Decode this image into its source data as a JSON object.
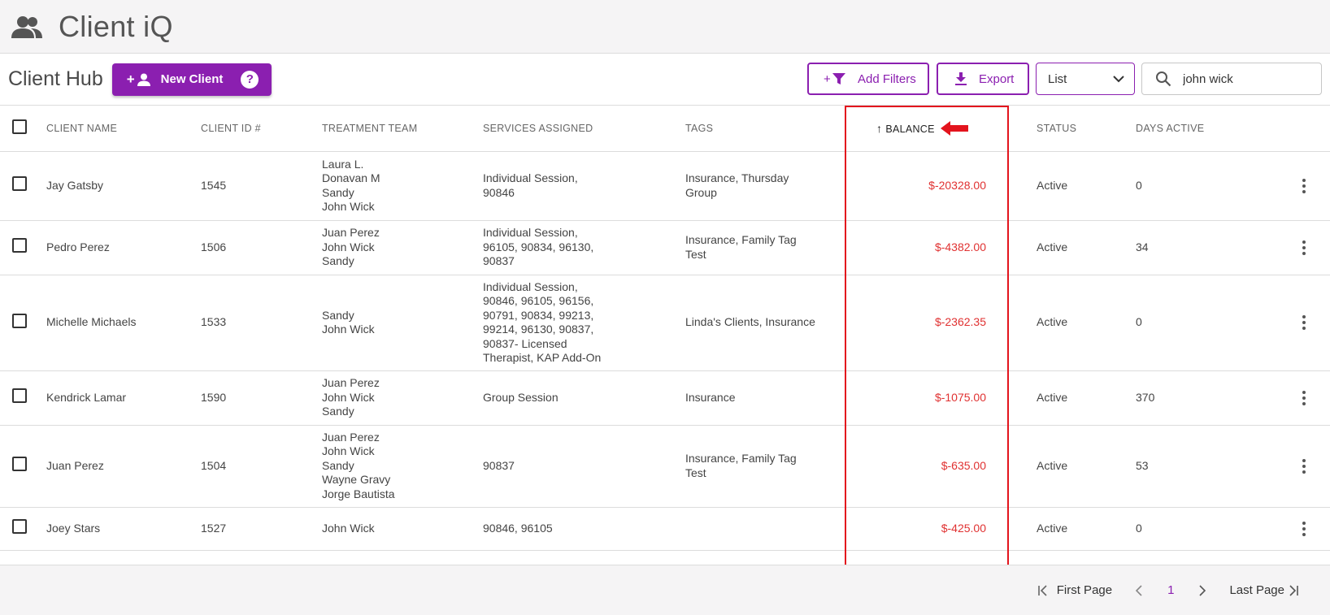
{
  "app": {
    "title": "Client iQ",
    "icon": "people-icon"
  },
  "hub": {
    "title": "Client Hub",
    "new_client_label": "New Client",
    "help_glyph": "?"
  },
  "toolbar": {
    "add_filters_label": "Add Filters",
    "export_label": "Export",
    "view_select": "List",
    "search_value": "john wick"
  },
  "table": {
    "headers": {
      "client_name": "CLIENT NAME",
      "client_id": "CLIENT ID #",
      "treatment_team": "TREATMENT TEAM",
      "services": "SERVICES ASSIGNED",
      "tags": "TAGS",
      "balance": "BALANCE",
      "status": "STATUS",
      "days_active": "DAYS ACTIVE"
    },
    "sort": {
      "column": "balance",
      "direction": "ascending"
    },
    "rows": [
      {
        "name": "Jay Gatsby",
        "id": "1545",
        "team": [
          "Laura L.",
          "Donavan M",
          "Sandy",
          "John Wick"
        ],
        "services": [
          "Individual Session,",
          "90846"
        ],
        "tags": [
          "Insurance, Thursday",
          "Group"
        ],
        "balance": "$-20328.00",
        "status": "Active",
        "days": "0"
      },
      {
        "name": "Pedro Perez",
        "id": "1506",
        "team": [
          "Juan Perez",
          "John Wick",
          "Sandy"
        ],
        "services": [
          "Individual Session,",
          "96105, 90834, 96130,",
          "90837"
        ],
        "tags": [
          "Insurance, Family Tag",
          "Test"
        ],
        "balance": "$-4382.00",
        "status": "Active",
        "days": "34"
      },
      {
        "name": "Michelle Michaels",
        "id": "1533",
        "team": [
          "Sandy",
          "John Wick"
        ],
        "services": [
          "Individual Session,",
          "90846, 96105, 96156,",
          "90791, 90834, 99213,",
          "99214, 96130, 90837,",
          "90837- Licensed",
          "Therapist, KAP Add-On"
        ],
        "tags": [
          "Linda's Clients, Insurance"
        ],
        "balance": "$-2362.35",
        "status": "Active",
        "days": "0"
      },
      {
        "name": "Kendrick Lamar",
        "id": "1590",
        "team": [
          "Juan Perez",
          "John Wick",
          "Sandy"
        ],
        "services": [
          "Group Session"
        ],
        "tags": [
          "Insurance"
        ],
        "balance": "$-1075.00",
        "status": "Active",
        "days": "370"
      },
      {
        "name": "Juan Perez",
        "id": "1504",
        "team": [
          "Juan Perez",
          "John Wick",
          "Sandy",
          "Wayne Gravy",
          "Jorge Bautista"
        ],
        "services": [
          "90837"
        ],
        "tags": [
          "Insurance, Family Tag",
          "Test"
        ],
        "balance": "$-635.00",
        "status": "Active",
        "days": "53"
      },
      {
        "name": "Joey Stars",
        "id": "1527",
        "team": [
          "John Wick"
        ],
        "services": [
          "90846, 96105"
        ],
        "tags": [],
        "balance": "$-425.00",
        "status": "Active",
        "days": "0"
      }
    ]
  },
  "pagination": {
    "first_label": "First Page",
    "current": "1",
    "last_label": "Last Page"
  },
  "colors": {
    "accent": "#8b1fb0",
    "negative": "#e03131",
    "highlight": "#e3141d"
  }
}
